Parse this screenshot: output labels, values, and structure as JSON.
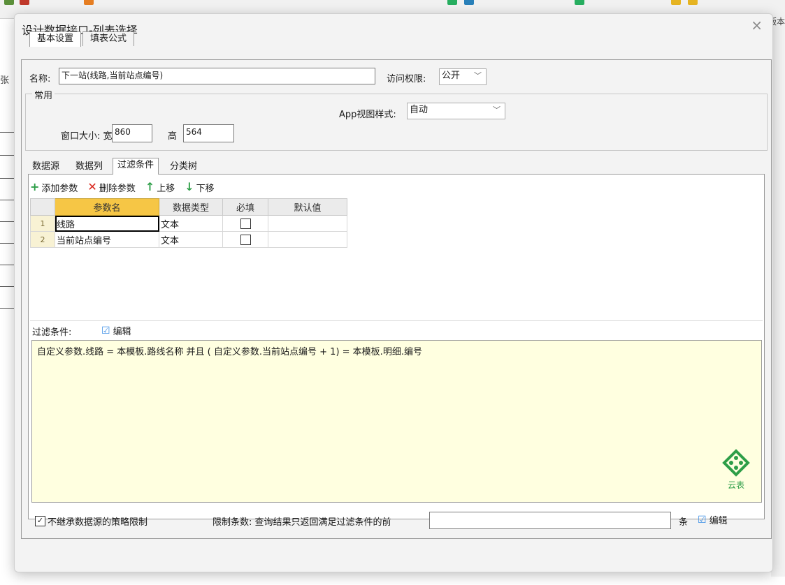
{
  "dialog": {
    "title": "设计数据接口-列表选择",
    "close_glyph": "×"
  },
  "main_tabs": [
    {
      "label": "基本设置",
      "active": true
    },
    {
      "label": "填表公式",
      "active": false
    }
  ],
  "form": {
    "name_label": "名称:",
    "name_value": "下一站(线路,当前站点编号)",
    "access_label": "访问权限:",
    "access_value": "公开",
    "group_label": "常用",
    "app_view_label": "App视图样式:",
    "app_view_value": "自动",
    "window_size_label": "窗口大小: 宽",
    "width_value": "860",
    "height_label": "高",
    "height_value": "564"
  },
  "sub_tabs": [
    {
      "label": "数据源",
      "active": false
    },
    {
      "label": "数据列",
      "active": false
    },
    {
      "label": "过滤条件",
      "active": true
    },
    {
      "label": "分类树",
      "active": false
    }
  ],
  "param_toolbar": {
    "add": "添加参数",
    "delete": "删除参数",
    "up": "上移",
    "down": "下移"
  },
  "param_table": {
    "columns": [
      "参数名",
      "数据类型",
      "必填",
      "默认值"
    ],
    "rows": [
      {
        "num": "1",
        "name": "线路",
        "type": "文本",
        "required": false,
        "default": ""
      },
      {
        "num": "2",
        "name": "当前站点编号",
        "type": "文本",
        "required": false,
        "default": ""
      }
    ]
  },
  "filter": {
    "label": "过滤条件:",
    "edit_label": "编辑",
    "expression": "自定义参数.线路  =  本模板.路线名称  并且 ( 自定义参数.当前站点编号  + 1) =  本模板.明细.编号",
    "logo_text": "云表"
  },
  "footer": {
    "inherit_label": "不继承数据源的策略限制",
    "inherit_checked": true,
    "limit_label": "限制条数: 查询结果只返回满足过滤条件的前",
    "limit_value": "",
    "unit_label": "条",
    "edit_label": "编辑"
  },
  "background": {
    "left_label": "张",
    "right_label": "版本"
  },
  "colors": {
    "accent_header": "#f6c645",
    "filter_bg": "#ffffe0",
    "add_green": "#2e9e48",
    "delete_red": "#d9261c",
    "edit_blue": "#3a8ee6"
  }
}
